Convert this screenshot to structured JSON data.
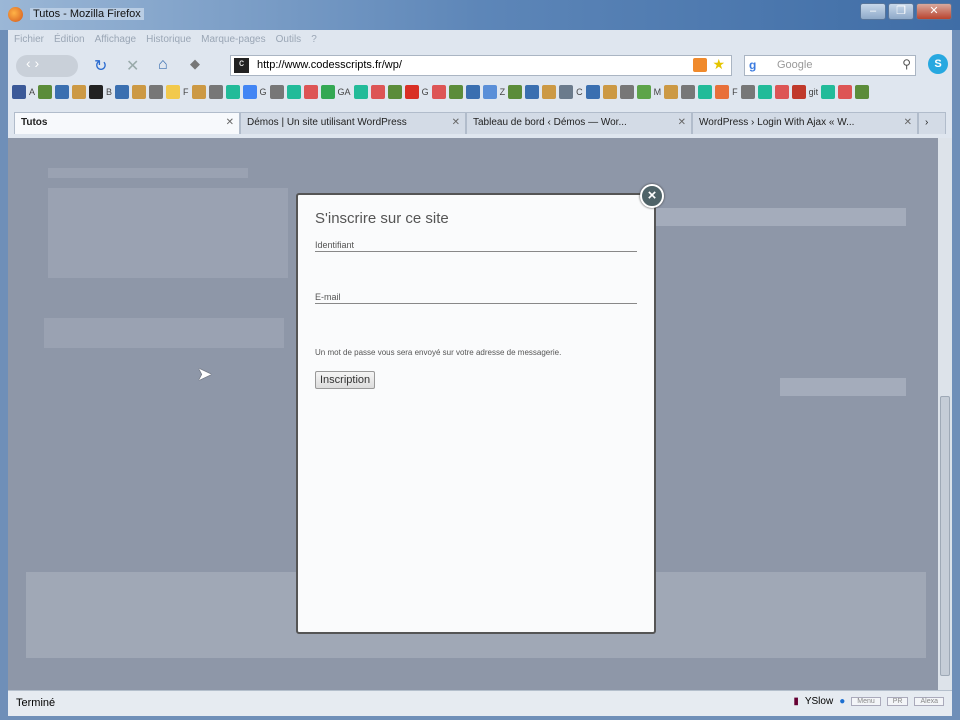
{
  "window": {
    "title": "Tutos - Mozilla Firefox",
    "minimize": "–",
    "maximize": "❐",
    "close": "✕"
  },
  "menu": [
    "Fichier",
    "Édition",
    "Affichage",
    "Historique",
    "Marque-pages",
    "Outils",
    "?"
  ],
  "nav": {
    "url": "http://www.codesscripts.fr/wp/",
    "search_placeholder": "Google"
  },
  "bookmarks": [
    {
      "label": "A",
      "color": "#3b5998"
    },
    {
      "label": "B",
      "color": "#222"
    },
    {
      "label": "F",
      "color": "#f2c94c"
    },
    {
      "label": "G",
      "color": "#4285f4"
    },
    {
      "label": "GA",
      "color": "#34a853"
    },
    {
      "label": "G",
      "color": "#d93025"
    },
    {
      "label": "Z",
      "color": "#5a8fd8"
    },
    {
      "label": "C",
      "color": "#6b7b8c"
    },
    {
      "label": "M",
      "color": "#5da44a"
    },
    {
      "label": "F",
      "color": "#e8703a"
    },
    {
      "label": "git",
      "color": "#c0392b"
    }
  ],
  "tabs": [
    {
      "label": "Tutos",
      "active": true
    },
    {
      "label": "Démos | Un site utilisant WordPress"
    },
    {
      "label": "Tableau de bord ‹ Démos — Wor..."
    },
    {
      "label": "WordPress › Login With Ajax « W..."
    }
  ],
  "modal": {
    "title": "S'inscrire sur ce site",
    "username_label": "Identifiant",
    "email_label": "E-mail",
    "note": "Un mot de passe vous sera envoyé sur votre adresse de messagerie.",
    "submit": "Inscription"
  },
  "status": {
    "text": "Terminé",
    "yslow": "YSlow",
    "menu": "Menu",
    "pr": "PR",
    "alexa": "Alexa"
  }
}
